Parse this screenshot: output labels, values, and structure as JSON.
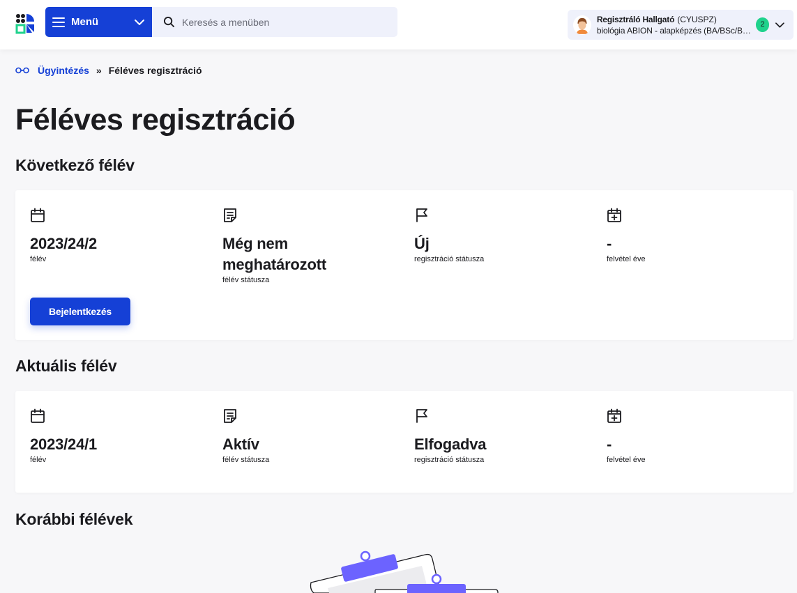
{
  "header": {
    "menu_label": "Menü",
    "search_placeholder": "Keresés a menüben",
    "user": {
      "name": "Regisztráló Hallgató",
      "code": "(CYUSPZ)",
      "program": "biológia ABION - alapképzés (BA/BSc/BPr...",
      "notification_count": "2"
    }
  },
  "breadcrumb": {
    "parent": "Ügyintézés",
    "separator": "»",
    "current": "Féléves regisztráció"
  },
  "page_title": "Féléves regisztráció",
  "next_semester": {
    "heading": "Következő félév",
    "items": [
      {
        "icon": "calendar-icon",
        "value": "2023/24/2",
        "caption": "félév"
      },
      {
        "icon": "document-icon",
        "value": "Még nem meghatározott",
        "caption": "félév státusza"
      },
      {
        "icon": "flag-icon",
        "value": "Új",
        "caption": "regisztráció státusza"
      },
      {
        "icon": "calendar-plus-icon",
        "value": "-",
        "caption": "felvétel éve"
      }
    ],
    "button_label": "Bejelentkezés"
  },
  "current_semester": {
    "heading": "Aktuális félév",
    "items": [
      {
        "icon": "calendar-icon",
        "value": "2023/24/1",
        "caption": "félév"
      },
      {
        "icon": "document-icon",
        "value": "Aktív",
        "caption": "félév státusza"
      },
      {
        "icon": "flag-icon",
        "value": "Elfogadva",
        "caption": "regisztráció státusza"
      },
      {
        "icon": "calendar-plus-icon",
        "value": "-",
        "caption": "felvétel éve"
      }
    ]
  },
  "previous_semesters": {
    "heading": "Korábbi félévek"
  },
  "colors": {
    "primary": "#1540d6",
    "accent": "#1fd28c",
    "illustration": "#6c63ff"
  }
}
